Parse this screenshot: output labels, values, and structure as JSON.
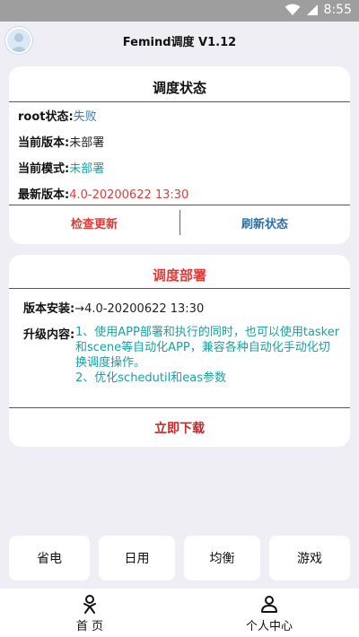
{
  "status_bar": {
    "time": "8:55",
    "icons": [
      "wifi-icon",
      "signal-icon"
    ]
  },
  "app_bar": {
    "title": "Femind调度 V1.12"
  },
  "status_card": {
    "title": "调度状态",
    "rows": [
      {
        "label": "root状态:",
        "value": "失败",
        "color": "#3f78b5"
      },
      {
        "label": "当前版本:",
        "value": "未部署",
        "color": "#222222"
      },
      {
        "label": "当前模式:",
        "value": "未部署",
        "color": "#17a2a2"
      },
      {
        "label": "最新版本:",
        "value": "4.0-20200622 13:30",
        "color": "#e53935"
      }
    ],
    "check_update": "检查更新",
    "refresh_status": "刷新状态"
  },
  "deploy_card": {
    "title": "调度部署",
    "install_label": "版本安装:",
    "install_value": "→4.0-20200622 13:30",
    "upgrade_label": "升级内容:",
    "upgrade_line1": "1、使用APP部署和执行的同时，也可以使用tasker和scene等自动化APP，兼容各种自动化手动化切换调度操作。",
    "upgrade_line2": "2、优化schedutil和eas参数",
    "download": "立即下载"
  },
  "modes": [
    "省电",
    "日用",
    "均衡",
    "游戏"
  ],
  "nav": {
    "home": "首 页",
    "profile": "个人中心"
  }
}
